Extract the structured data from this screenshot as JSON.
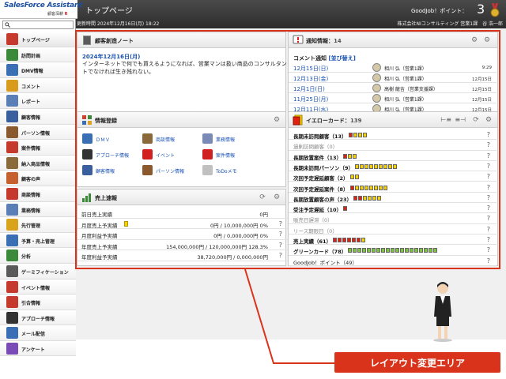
{
  "app": {
    "logo": "SalesForce Assistant",
    "logo_sub_a": "顧客深耕",
    "logo_sub_b": "R",
    "page_title": "トップページ",
    "goodjob_label": "GoodJob！ポイント：",
    "goodjob_value": "3",
    "updated": "更新時間 2024年12月16日(月) 18:22",
    "company": "株式会社NIコンサルティング 営業1課　谷 浩一郎"
  },
  "search": {
    "placeholder": ""
  },
  "sidebar": {
    "items": [
      {
        "label": "トップページ",
        "icon": "house-icon",
        "color": "#c63a2e"
      },
      {
        "label": "訪問計画",
        "icon": "calendar-icon",
        "color": "#3a8a3a"
      },
      {
        "label": "DMV情報",
        "icon": "chart-icon",
        "color": "#3a6fb6"
      },
      {
        "label": "コメント",
        "icon": "comment-icon",
        "color": "#d99b1c"
      },
      {
        "label": "レポート",
        "icon": "report-icon",
        "color": "#5a7fb6"
      },
      {
        "label": "顧客情報",
        "icon": "building-icon",
        "color": "#3a5f9e"
      },
      {
        "label": "パーソン情報",
        "icon": "person-icon",
        "color": "#8a5a2e"
      },
      {
        "label": "案件情報",
        "icon": "target-icon",
        "color": "#c63a2e"
      },
      {
        "label": "納入商品情報",
        "icon": "box-icon",
        "color": "#8a6a3a"
      },
      {
        "label": "顧客の声",
        "icon": "voice-icon",
        "color": "#c6602e"
      },
      {
        "label": "商談情報",
        "icon": "book-icon",
        "color": "#c63a2e"
      },
      {
        "label": "業務情報",
        "icon": "clipboard-icon",
        "color": "#5a7fb6"
      },
      {
        "label": "先行管理",
        "icon": "flower-icon",
        "color": "#d9a31c"
      },
      {
        "label": "予算・売上管理",
        "icon": "graph-icon",
        "color": "#3a6fb6"
      },
      {
        "label": "分析",
        "icon": "analysis-icon",
        "color": "#3a8a3a"
      },
      {
        "label": "ゲーミフィケーション",
        "icon": "game-icon",
        "color": "#5a5a5a"
      },
      {
        "label": "イベント情報",
        "icon": "flag-icon",
        "color": "#c63a2e"
      },
      {
        "label": "引合情報",
        "icon": "inquiry-icon",
        "color": "#c63a2e"
      },
      {
        "label": "アプローチ情報",
        "icon": "headset-icon",
        "color": "#333333"
      },
      {
        "label": "メール配信",
        "icon": "mail-icon",
        "color": "#3a6fb6"
      },
      {
        "label": "アンケート",
        "icon": "rainbow-icon",
        "color": "#7a4ab6"
      }
    ]
  },
  "notebook": {
    "title": "顧客創造ノート",
    "date": "2024年12月16日(月)",
    "text": "インターネットで何でも買えるようになれば、営業マンは扱い商品のコンサルタントでなければ生き残れない。"
  },
  "notices": {
    "title": "通知情報：",
    "count": "14",
    "sub": "コメント通知",
    "sub_link": "[並び替え]",
    "rows": [
      {
        "date": "12月15日(日)",
        "name": "相川 弘（営業1課）",
        "time": "9:29"
      },
      {
        "date": "12月13日(金)",
        "name": "相川 弘（営業1課）",
        "time": "12月15日"
      },
      {
        "date": "12月1日(日)",
        "name": "高樹 龍吉（営業支援課）",
        "time": "12月15日"
      },
      {
        "date": "11月25日(月)",
        "name": "相川 弘（営業1課）",
        "time": "12月15日"
      },
      {
        "date": "12月11日(水)",
        "name": "相川 弘（営業1課）",
        "time": "12月15日"
      }
    ]
  },
  "register": {
    "title": "情報登録",
    "items": [
      {
        "label": "ＤＭＶ",
        "icon": "grid-icon"
      },
      {
        "label": "商談情報",
        "icon": "briefcase-icon"
      },
      {
        "label": "業務情報",
        "icon": "clipboard-icon"
      },
      {
        "label": "アプローチ情報",
        "icon": "headset-icon"
      },
      {
        "label": "イベント",
        "icon": "flag-icon"
      },
      {
        "label": "案件情報",
        "icon": "target-icon"
      },
      {
        "label": "顧客情報",
        "icon": "building-icon"
      },
      {
        "label": "パーソン情報",
        "icon": "person-icon"
      },
      {
        "label": "ToDoメモ",
        "icon": "memo-icon"
      }
    ]
  },
  "sales": {
    "title": "売上速報",
    "rows": [
      {
        "label": "前日売上実績",
        "value": "0円",
        "q": "",
        "mark": false
      },
      {
        "label": "月度売上予実績",
        "value": "0円 / 10,000,000円 0%",
        "q": "?",
        "mark": true
      },
      {
        "label": "月度利益予実績",
        "value": "0円 / 0,000,000円 0%",
        "q": "?",
        "mark": false
      },
      {
        "label": "年度売上予実績",
        "value": "154,000,000円 / 120,000,000円 128.3%",
        "q": "?",
        "mark": false
      },
      {
        "label": "年度利益予実績",
        "value": "38,720,000円 / 0,000,000円",
        "q": "?",
        "mark": false
      }
    ]
  },
  "yellow": {
    "title": "イエローカード：",
    "count": "139",
    "rows": [
      {
        "label": "長期未訪問顧客（13）",
        "style": "b",
        "bar": "RYYY",
        "q": "?"
      },
      {
        "label": "過剰訪問顧客（0）",
        "style": "g",
        "bar": "",
        "q": "?"
      },
      {
        "label": "長期放置案件（13）",
        "style": "b",
        "bar": "RYY",
        "q": "?"
      },
      {
        "label": "長期未訪問パーソン（9）",
        "style": "b",
        "bar": "YYYYYYYYY",
        "q": "?"
      },
      {
        "label": "次回予定遅延顧客（2）",
        "style": "b",
        "bar": "YY",
        "q": "?"
      },
      {
        "label": "次回予定遅延案件（8）",
        "style": "b",
        "bar": "RYYYYYYY",
        "q": "?"
      },
      {
        "label": "長期放置顧客の声（23）",
        "style": "b",
        "bar": "RRYYYY",
        "q": "?"
      },
      {
        "label": "受注予定遅延（10）",
        "style": "b",
        "bar": "R",
        "q": "?"
      },
      {
        "label": "販売日遅滞（0）",
        "style": "g",
        "bar": "",
        "q": "?"
      },
      {
        "label": "リース期限日（0）",
        "style": "g",
        "bar": "",
        "q": "?"
      },
      {
        "label": "売上実績（61）",
        "style": "b",
        "bar": "RRRRRRY",
        "q": "?"
      },
      {
        "label": "グリーンカード（78）",
        "style": "b",
        "bar": "GGGGGGGGGGGGGGGGGGG",
        "q": "?"
      },
      {
        "label": "GoodJob！ポイント（49）",
        "style": "n",
        "bar": "",
        "q": "?"
      }
    ]
  },
  "footer": {
    "badge": "レイアウト変更エリア"
  }
}
